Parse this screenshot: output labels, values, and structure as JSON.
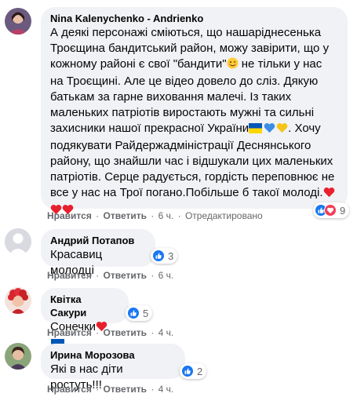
{
  "comments": [
    {
      "author": "Nina Kalenychenko - Andrienko",
      "text_lines": [
        "А деякі персонажі сміються, що нашаріднесенька",
        "Троєщина бандитський район, можу завірити, що у",
        "кожному районі є свої \"бандити\"",
        " не тільки у нас",
        "на Троєщині. Але це відео довело до сліз. Дякую",
        "батькам за гарне виховання малечі. Із таких",
        "маленьких патріотів виростають мужні та сильні",
        "захисники нашої прекрасної України",
        ". Хочу",
        "подякувати Райдержадміністрації Деснянського",
        "району, що знайшли час і відшукали цих маленьких",
        "патріотів. Серце радується, гордість переповнює не",
        "все у нас на Трої погано.Побільше б такої молоді."
      ],
      "like": "Нравится",
      "reply": "Ответить",
      "time": "6 ч.",
      "edited": "Отредактировано",
      "reactions_count": "9"
    },
    {
      "author": "Андрий Потапов",
      "text": "Красавиц молодці",
      "like": "Нравится",
      "reply": "Ответить",
      "time": "6 ч.",
      "reactions_count": "3"
    },
    {
      "author": "Квітка Сакури",
      "text": "Сонечки",
      "like": "Нравится",
      "reply": "Ответить",
      "time": "4 ч.",
      "reactions_count": "5"
    },
    {
      "author": "Ирина Морозова",
      "text": "Які в нас діти ростуть!!!",
      "like": "Нравится",
      "reply": "Ответить",
      "time": "4 ч.",
      "reactions_count": "2"
    }
  ],
  "separator": "·",
  "icons": {
    "like": "like-icon",
    "love": "love-icon",
    "wink": "wink-emoji",
    "flag": "ukraine-flag-emoji",
    "blue_heart": "blue-heart-emoji",
    "yellow_heart": "yellow-heart-emoji",
    "red_heart": "red-heart-emoji"
  },
  "colors": {
    "bubble": "#f0f2f5",
    "meta": "#65676b",
    "like_blue": "#1877f2",
    "love_red": "#f33e58",
    "flag_blue": "#0057b7",
    "flag_yellow": "#ffd700"
  }
}
